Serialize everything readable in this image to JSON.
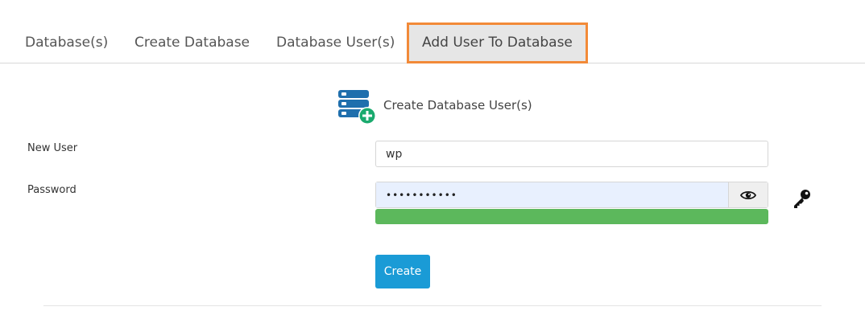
{
  "tabs": [
    {
      "label": "Database(s)",
      "active": false
    },
    {
      "label": "Create Database",
      "active": false
    },
    {
      "label": "Database User(s)",
      "active": false
    },
    {
      "label": "Add User To Database",
      "active": true
    }
  ],
  "section": {
    "title": "Create Database User(s)",
    "icon": "database-add-icon"
  },
  "form": {
    "new_user_label": "New User",
    "new_user_value": "wp",
    "password_label": "Password",
    "password_value": "•••••••••••",
    "show_password_icon": "eye-icon",
    "generate_password_icon": "key-icon",
    "strength_percent": 100,
    "submit_label": "Create"
  },
  "colors": {
    "active_tab_border": "#f28a38",
    "strength_fill": "#5cb85c",
    "button_primary": "#1a9bd6",
    "icon_blue": "#1f6fad",
    "icon_green": "#1aaa6e"
  }
}
